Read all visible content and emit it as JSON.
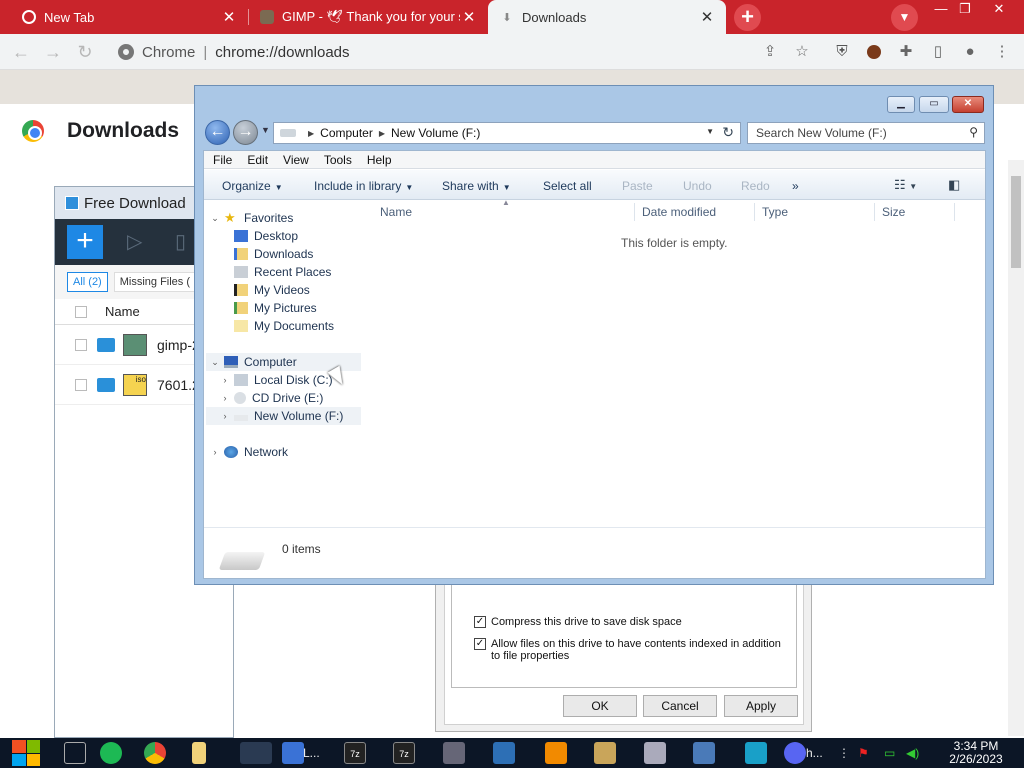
{
  "browser": {
    "tabs": [
      {
        "title": "New Tab",
        "active": false
      },
      {
        "title": "GIMP - 🕊 Thank you for your s",
        "active": false
      },
      {
        "title": "Downloads",
        "active": true
      }
    ],
    "address_site": "Chrome",
    "address_url": "chrome://downloads",
    "page_title": "Downloads"
  },
  "fdm": {
    "title": "Free Download",
    "filters": [
      "All (2)",
      "Missing Files ("
    ],
    "column_name": "Name",
    "rows": [
      {
        "name": "gimp-2"
      },
      {
        "name": "7601.2"
      }
    ],
    "iso_label": "iso"
  },
  "props": {
    "compress_label": "Compress this drive to save disk space",
    "index_label": "Allow files on this drive to have contents indexed in addition to file properties",
    "ok": "OK",
    "cancel": "Cancel",
    "apply": "Apply"
  },
  "explorer": {
    "breadcrumbs": [
      "Computer",
      "New Volume (F:)"
    ],
    "search_placeholder": "Search New Volume (F:)",
    "menu": [
      "File",
      "Edit",
      "View",
      "Tools",
      "Help"
    ],
    "commands": {
      "organize": "Organize",
      "include": "Include in library",
      "share": "Share with",
      "select_all": "Select all",
      "paste": "Paste",
      "undo": "Undo",
      "redo": "Redo",
      "more": "»"
    },
    "nav": {
      "favorites": "Favorites",
      "desktop": "Desktop",
      "downloads": "Downloads",
      "recent": "Recent Places",
      "videos": "My Videos",
      "pictures": "My Pictures",
      "documents": "My Documents",
      "computer": "Computer",
      "local_disk": "Local Disk (C:)",
      "cd_drive": "CD Drive (E:)",
      "new_volume": "New Volume (F:)",
      "network": "Network"
    },
    "columns": {
      "name": "Name",
      "date": "Date modified",
      "type": "Type",
      "size": "Size"
    },
    "empty_message": "This folder is empty.",
    "items_count": "0 items"
  },
  "taskbar": {
    "app_label_1": "L...",
    "app_label_2": "h...",
    "time": "3:34 PM",
    "date": "2/26/2023",
    "sevenzip": "7z"
  }
}
